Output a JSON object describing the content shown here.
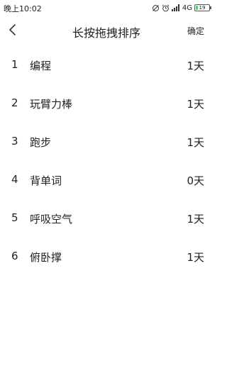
{
  "status_bar": {
    "time": "晚上10:02",
    "network": "4G",
    "battery": "19",
    "battery_level": 0.19
  },
  "header": {
    "title": "长按拖拽排序",
    "confirm_label": "确定",
    "back_icon": "chevron-left-icon"
  },
  "items": [
    {
      "index": "1",
      "name": "编程",
      "days": "1天"
    },
    {
      "index": "2",
      "name": "玩臂力棒",
      "days": "1天"
    },
    {
      "index": "3",
      "name": "跑步",
      "days": "1天"
    },
    {
      "index": "4",
      "name": "背单词",
      "days": "0天"
    },
    {
      "index": "5",
      "name": "呼吸空气",
      "days": "1天"
    },
    {
      "index": "6",
      "name": "俯卧撑",
      "days": "1天"
    }
  ]
}
